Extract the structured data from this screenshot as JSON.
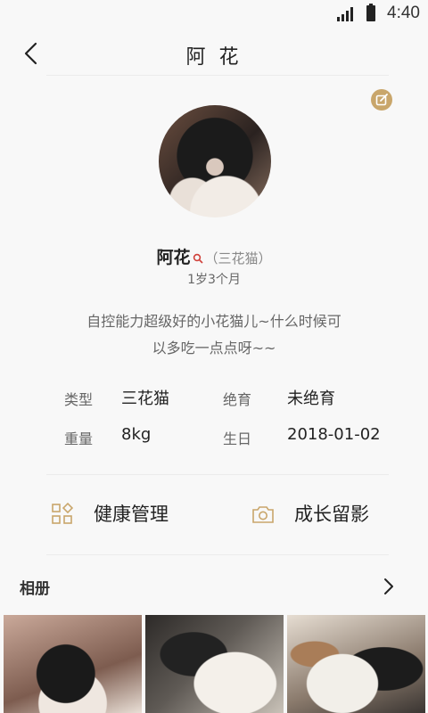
{
  "status_bar": {
    "time": "4:40"
  },
  "header": {
    "title": "阿 花"
  },
  "profile": {
    "name": "阿花",
    "breed": "（三花猫）",
    "age": "1岁3个月",
    "bio_line1": "自控能力超级好的小花猫儿~什么时候可",
    "bio_line2": "以多吃一点点呀~~"
  },
  "info": {
    "type_label": "类型",
    "type_value": "三花猫",
    "neuter_label": "绝育",
    "neuter_value": "未绝育",
    "weight_label": "重量",
    "weight_value": "8kg",
    "birthday_label": "生日",
    "birthday_value": "2018-01-02"
  },
  "actions": {
    "health": "健康管理",
    "growth": "成长留影"
  },
  "album": {
    "title": "相册"
  },
  "colors": {
    "accent": "#c9a66b",
    "female": "#d0413a"
  },
  "icons": {
    "back": "chevron-left-icon",
    "edit": "edit-icon",
    "gender": "female-icon",
    "health": "grid-icon",
    "growth": "camera-icon",
    "album_more": "chevron-right-icon"
  }
}
